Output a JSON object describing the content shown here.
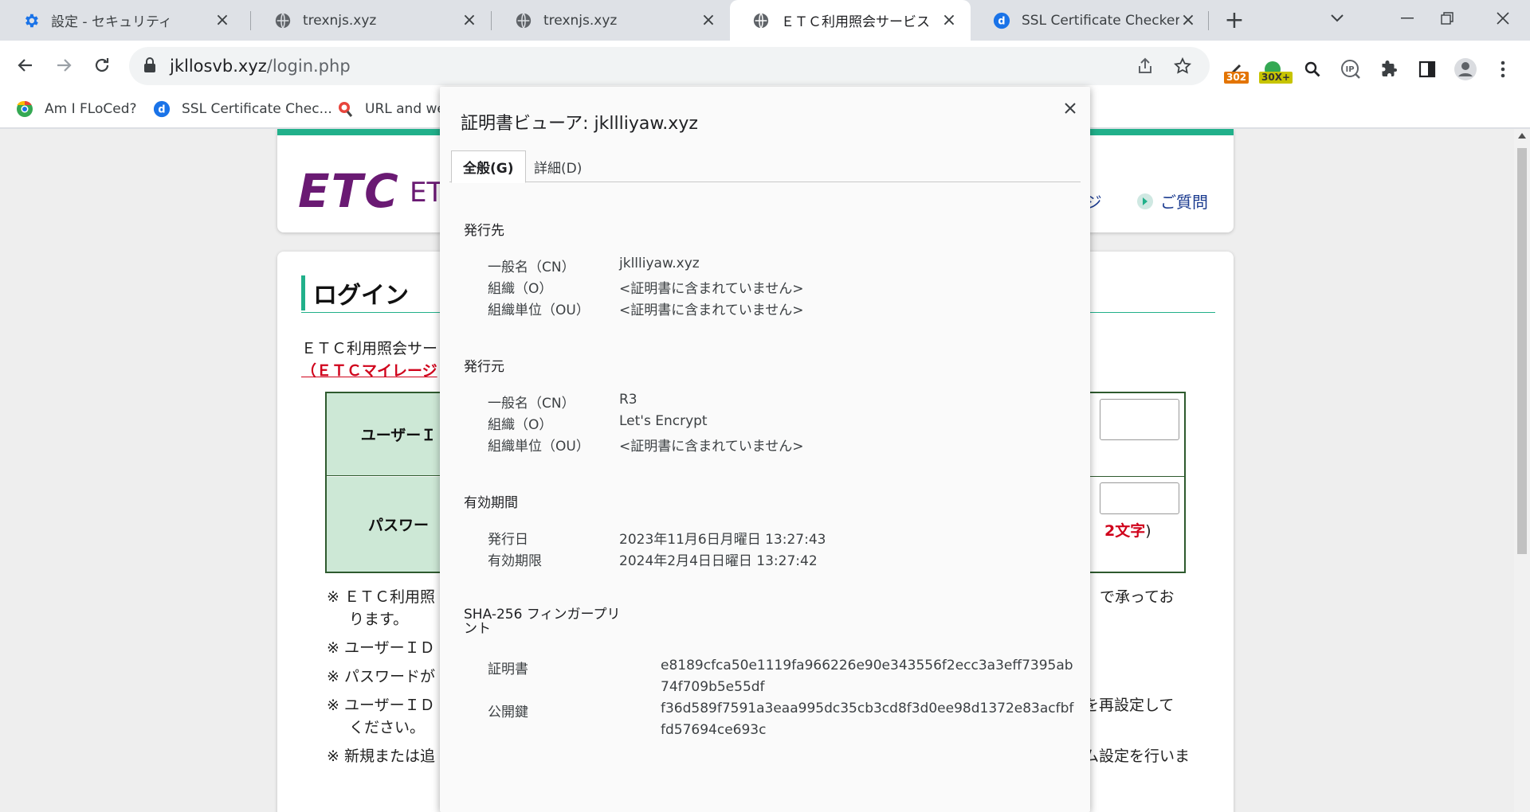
{
  "tabs": [
    {
      "label": "設定 - セキュリティ",
      "icon": "gear-icon"
    },
    {
      "label": "trexnjs.xyz",
      "icon": "globe-icon"
    },
    {
      "label": "trexnjs.xyz",
      "icon": "globe-icon"
    },
    {
      "label": "ＥＴＣ利用照会サービス",
      "icon": "globe-icon"
    },
    {
      "label": "SSL Certificate Checker -",
      "icon": "d-logo-icon"
    }
  ],
  "address_bar": {
    "host": "jkllosvb.xyz",
    "path": "/login.php"
  },
  "extensions": {
    "badge_1": "302",
    "badge_2": "30X+",
    "ip_label": "IP"
  },
  "bookmarks": [
    {
      "label": "Am I FLoCed?",
      "icon": "chrome-circle-icon"
    },
    {
      "label": "SSL Certificate Chec...",
      "icon": "d-logo-icon"
    },
    {
      "label": "URL and we",
      "icon": "magnifier-icon"
    }
  ],
  "page": {
    "logo": "ETC",
    "logo_sub": "ET",
    "header_link_1": "ージ",
    "header_link_2": "ご質問",
    "login_title": "ログイン",
    "intro_line1": "ＥＴＣ利用照会サー",
    "intro_line2": "（ＥＴＣマイレージ",
    "user_id_label": "ユーザーＩ",
    "password_label": "パスワー",
    "password_note_red": "2文字",
    "password_note_end": ")",
    "notes": [
      "※ ＥＴＣ利用照",
      "ります。",
      "※ ユーザーＩＤ",
      "※ パスワードが",
      "※ ユーザーＩＤ",
      "ください。",
      "※ 新規または追"
    ],
    "notes_right": [
      "で承ってお",
      "を再設定して",
      "ム設定を行いま"
    ]
  },
  "dialog": {
    "title": "証明書ビューア: jkllliyaw.xyz",
    "tabs": [
      {
        "label": "全般(G)",
        "selected": true
      },
      {
        "label": "詳細(D)",
        "selected": false
      }
    ],
    "issued_to": {
      "heading": "発行先",
      "rows": [
        {
          "key": "一般名（CN）",
          "value": "jkllliyaw.xyz"
        },
        {
          "key": "組織（O）",
          "value": "<証明書に含まれていません>"
        },
        {
          "key": "組織単位（OU）",
          "value": "<証明書に含まれていません>"
        }
      ]
    },
    "issued_by": {
      "heading": "発行元",
      "rows": [
        {
          "key": "一般名（CN）",
          "value": "R3"
        },
        {
          "key": "組織（O）",
          "value": "Let's Encrypt"
        },
        {
          "key": "組織単位（OU）",
          "value": "<証明書に含まれていません>"
        }
      ]
    },
    "validity": {
      "heading": "有効期間",
      "rows": [
        {
          "key": "発行日",
          "value": "2023年11月6日月曜日 13:27:43"
        },
        {
          "key": "有効期限",
          "value": "2024年2月4日日曜日 13:27:42"
        }
      ]
    },
    "fingerprints": {
      "heading_line1": "SHA-256 フィンガープリ",
      "heading_line2": "ント",
      "rows": [
        {
          "key": "証明書",
          "value": "e8189cfca50e1119fa966226e90e343556f2ecc3a3eff7395ab74f709b5e55df"
        },
        {
          "key": "公開鍵",
          "value": "f36d589f7591a3eaa995dc35cb3cd8f3d0ee98d1372e83acfbffd57694ce693c"
        }
      ]
    }
  },
  "colors": {
    "etc_purple": "#6a1a73",
    "accent_green": "#21b08a",
    "chrome_blue": "#1a73e8"
  }
}
